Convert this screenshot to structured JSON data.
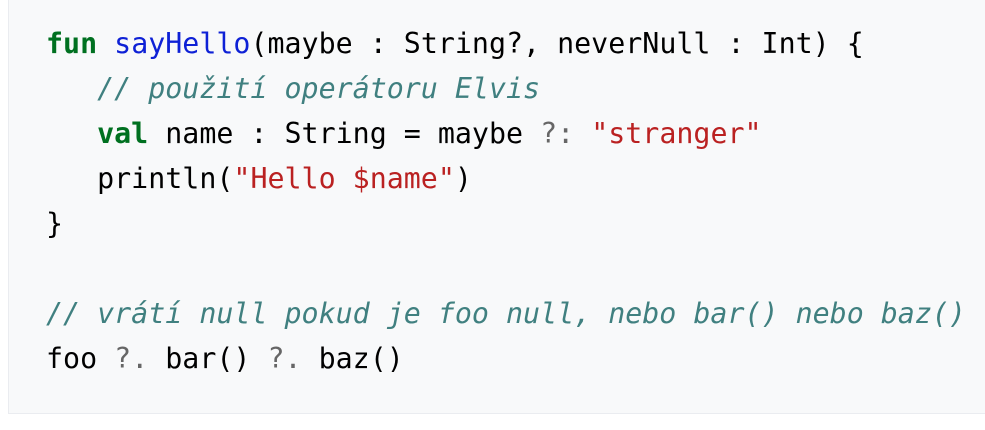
{
  "code": {
    "line1": {
      "keyword": "fun",
      "function_name": "sayHello",
      "params": "(maybe : String?, neverNull : Int) {"
    },
    "line2": {
      "indent": "   ",
      "comment": "// použití operátoru Elvis"
    },
    "line3": {
      "indent": "   ",
      "keyword": "val",
      "text": " name : String = maybe ",
      "operator": "?:",
      "string": "\"stranger\""
    },
    "line4": {
      "indent": "   ",
      "text": "println(",
      "string": "\"Hello $name\"",
      "close": ")"
    },
    "line5": {
      "text": "}"
    },
    "line7": {
      "comment": "// vrátí null pokud je foo null, nebo bar() nebo baz() vrátí null"
    },
    "line8": {
      "text_a": "foo ",
      "op_a": "?.",
      "text_b": " bar() ",
      "op_b": "?.",
      "text_c": " baz()"
    }
  },
  "colors": {
    "background": "#f8f9fa",
    "keyword": "#007020",
    "function": "#0e21d6",
    "comment": "#408080",
    "string": "#ba2121",
    "operator": "#666666"
  }
}
